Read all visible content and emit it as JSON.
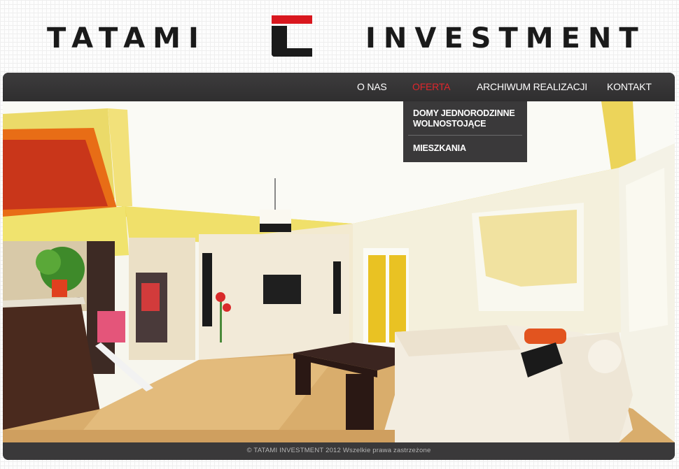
{
  "brand": {
    "left": "TATAMI",
    "right": "INVESTMENT"
  },
  "nav": {
    "items": [
      "O NAS",
      "OFERTA",
      "ARCHIWUM REALIZACJI",
      "KONTAKT"
    ],
    "active": "OFERTA"
  },
  "dropdown": {
    "item1_line1": "DOMY JEDNORODZINNE",
    "item1_line2": "WOLNOSTOJĄCE",
    "item2": "MIESZKANIA"
  },
  "footer": {
    "copyright": "© TATAMI INVESTMENT 2012 Wszelkie prawa zastrzeżone"
  },
  "colors": {
    "accent": "#e0262c",
    "logo_red": "#d9171e",
    "nav_bg": "#333233",
    "text": "#1a1a1a"
  },
  "icons": {
    "logo": "tatami-investment-logo"
  }
}
